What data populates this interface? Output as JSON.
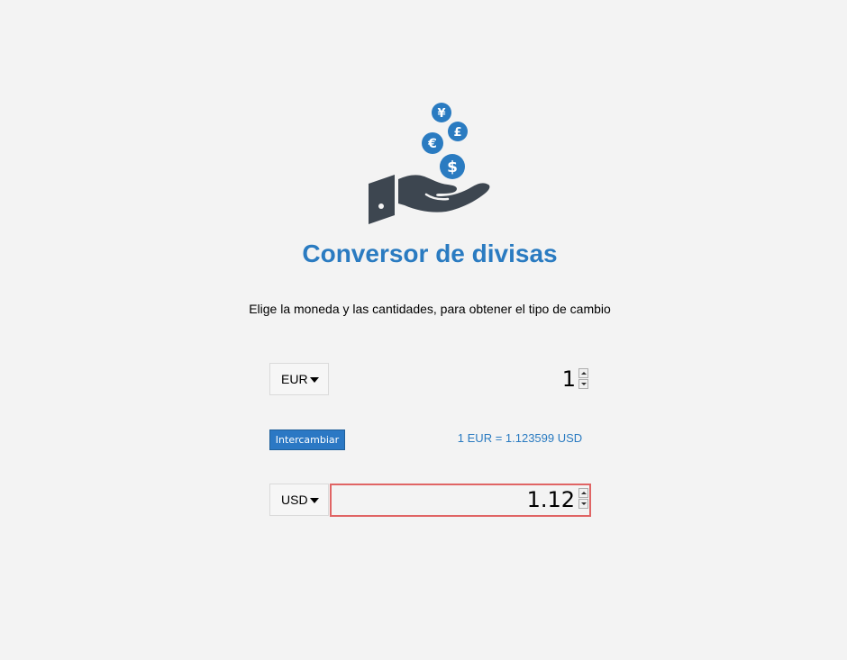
{
  "app": {
    "title": "Conversor de divisas",
    "subtitle": "Elige la moneda y las cantidades, para obtener el tipo de cambio"
  },
  "logo": {
    "icon": "hand-with-currency-coins-icon",
    "coins": [
      "¥",
      "£",
      "€",
      "$"
    ],
    "coin_color": "#2a7bc1",
    "hand_color": "#3d4650"
  },
  "from": {
    "currency": "EUR",
    "amount": "1"
  },
  "to": {
    "currency": "USD",
    "amount": "1.12"
  },
  "swap_label": "Intercambiar",
  "rate_text": "1 EUR = 1.123599 USD",
  "colors": {
    "accent": "#2a7bc1",
    "error_border": "#e06464",
    "background": "#f3f3f3"
  }
}
